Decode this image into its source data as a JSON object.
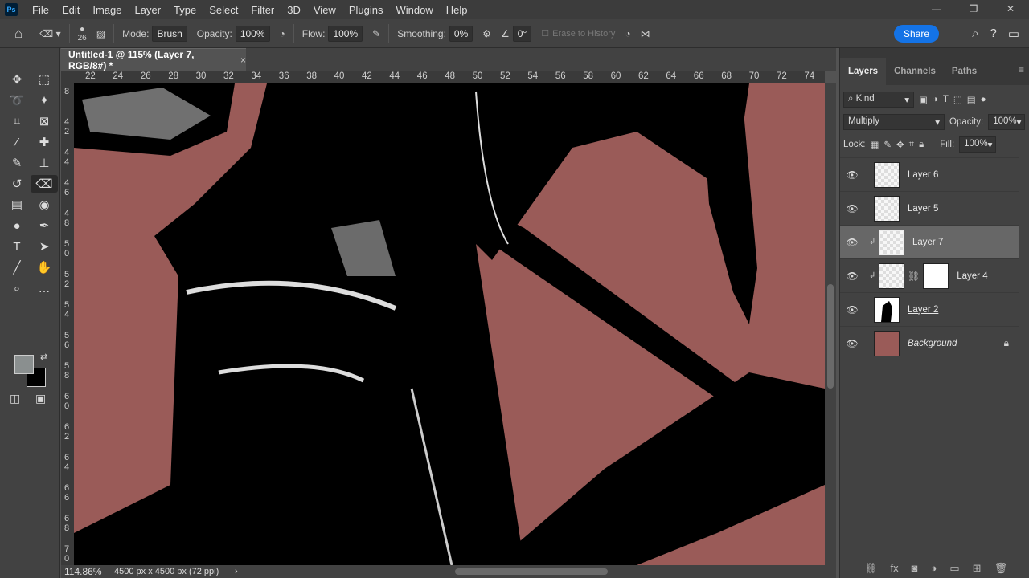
{
  "app": {
    "logo": "Ps"
  },
  "menu": [
    "File",
    "Edit",
    "Image",
    "Layer",
    "Type",
    "Select",
    "Filter",
    "3D",
    "View",
    "Plugins",
    "Window",
    "Help"
  ],
  "options": {
    "brush_size": "26",
    "mode_label": "Mode:",
    "mode_value": "Brush",
    "opacity_label": "Opacity:",
    "opacity_value": "100%",
    "flow_label": "Flow:",
    "flow_value": "100%",
    "smoothing_label": "Smoothing:",
    "smoothing_value": "0%",
    "angle_value": "0°",
    "erase_to_history": "Erase to History",
    "share": "Share"
  },
  "document": {
    "tab_title": "Untitled-1 @ 115% (Layer 7, RGB/8#) *",
    "close": "×"
  },
  "ruler": {
    "h": [
      "22",
      "24",
      "26",
      "28",
      "30",
      "32",
      "34",
      "36",
      "38",
      "40",
      "42",
      "44",
      "46",
      "48",
      "50",
      "52",
      "54",
      "56",
      "58",
      "60",
      "62",
      "64",
      "66",
      "68",
      "70",
      "72",
      "74"
    ],
    "v": [
      "8",
      "42",
      "44",
      "46",
      "48",
      "50",
      "52",
      "54",
      "56",
      "58",
      "60",
      "62",
      "64",
      "66",
      "68",
      "70"
    ]
  },
  "status": {
    "zoom": "114.86%",
    "size": "4500 px x 4500 px (72 ppi)",
    "arrow": "›"
  },
  "colors": {
    "canvas_bg": "#9a5b58",
    "foreground": "#8a8f8f",
    "background": "#000000",
    "accent": "#1473e6"
  },
  "layers_panel": {
    "tabs": [
      "Layers",
      "Channels",
      "Paths"
    ],
    "filter": "Kind",
    "blend": "Multiply",
    "opacity_label": "Opacity:",
    "opacity": "100%",
    "lock_label": "Lock:",
    "fill_label": "Fill:",
    "fill": "100%",
    "layers": [
      {
        "name": "Layer 6"
      },
      {
        "name": "Layer 5"
      },
      {
        "name": "Layer 7"
      },
      {
        "name": "Layer 4"
      },
      {
        "name": "Layer 2"
      },
      {
        "name": "Background"
      }
    ]
  }
}
